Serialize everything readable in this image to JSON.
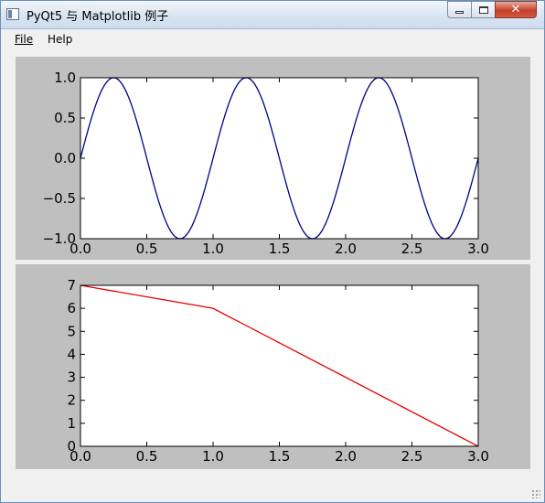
{
  "window": {
    "title": "PyQt5 与 Matplotlib 例子",
    "minimize_label": "–",
    "maximize_label": "□",
    "close_label": "✕"
  },
  "menu": {
    "file": "File",
    "help": "Help"
  },
  "icons": [
    "app-window-icon",
    "minimize-icon",
    "maximize-icon",
    "close-icon",
    "size-grip-icon"
  ],
  "colors": {
    "canvas_background": "#bfbfbf",
    "sine_line": "#00008b",
    "line_plot": "#e60000"
  },
  "chart_data": [
    {
      "type": "line",
      "title": "",
      "xlabel": "",
      "ylabel": "",
      "function": "sin(2*pi*t)",
      "xlim": [
        0.0,
        3.0
      ],
      "ylim": [
        -1.0,
        1.0
      ],
      "xticks": [
        "0.0",
        "0.5",
        "1.0",
        "1.5",
        "2.0",
        "2.5",
        "3.0"
      ],
      "yticks": [
        "1.0",
        "0.5",
        "0.0",
        "−0.5",
        "−1.0"
      ],
      "series": [
        {
          "color": "#00008b",
          "x_start": 0.0,
          "x_end": 3.0,
          "samples": 301
        }
      ],
      "grid": false
    },
    {
      "type": "line",
      "title": "",
      "xlabel": "",
      "ylabel": "",
      "xlim": [
        0.0,
        3.0
      ],
      "ylim": [
        0,
        7
      ],
      "xticks": [
        "0.0",
        "0.5",
        "1.0",
        "1.5",
        "2.0",
        "2.5",
        "3.0"
      ],
      "yticks": [
        "7",
        "6",
        "5",
        "4",
        "3",
        "2",
        "1",
        "0"
      ],
      "series": [
        {
          "color": "#e60000",
          "x": [
            0.0,
            1.0,
            3.0
          ],
          "y": [
            7,
            6,
            0
          ]
        }
      ],
      "grid": false
    }
  ]
}
